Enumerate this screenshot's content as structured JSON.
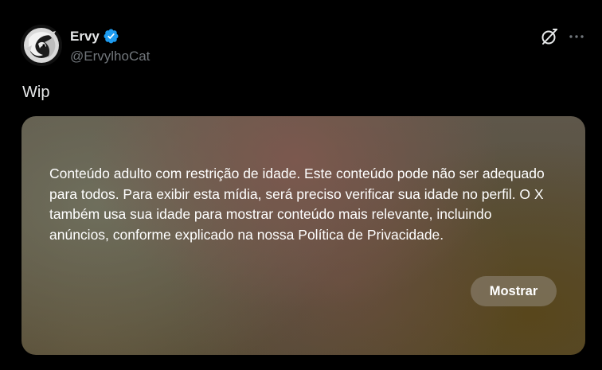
{
  "author": {
    "display_name": "Ervy",
    "handle": "@ErvylhoCat",
    "verified_icon": "verified-badge-icon",
    "verified_color": "#1d9bf0",
    "avatar_icon": "dragon-avatar"
  },
  "actions": {
    "grok_icon": "grok-slash-icon",
    "more_icon": "more-dots-icon"
  },
  "post": {
    "text": "Wip"
  },
  "media": {
    "warning_text": "Conteúdo adulto com restrição de idade. Este conteúdo pode não ser adequado para todos. Para exibir esta mídia, será preciso verificar sua idade no perfil. O X também usa sua idade para mostrar conteúdo mais relevante, incluindo anúncios, conforme explicado na nossa Política de Privacidade.",
    "show_button_label": "Mostrar"
  },
  "colors": {
    "background": "#000000",
    "primary_text": "#e7e9ea",
    "secondary_text": "#71767b"
  }
}
